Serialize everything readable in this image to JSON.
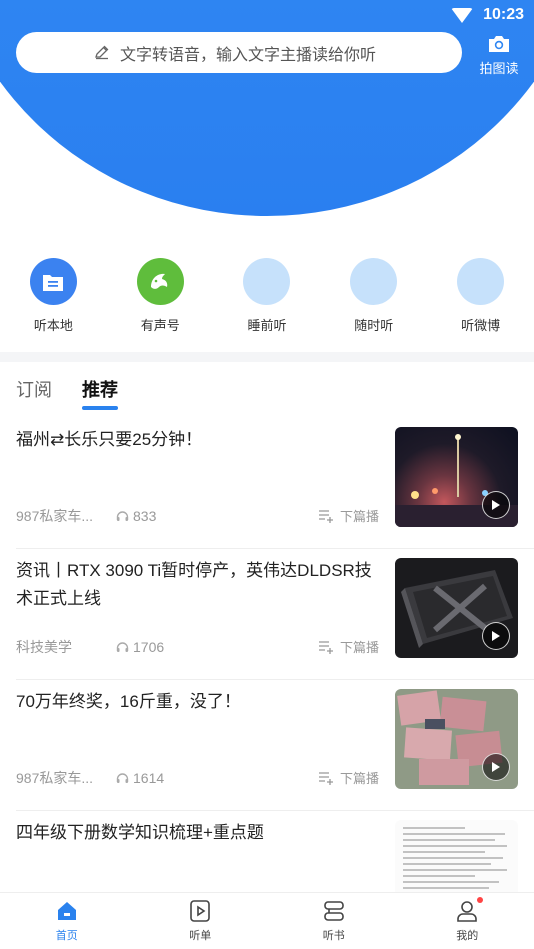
{
  "status": {
    "time": "10:23"
  },
  "search": {
    "placeholder": "文字转语音，输入文字主播读给你听"
  },
  "photo_read": {
    "label": "拍图读"
  },
  "categories": [
    {
      "label": "听本地",
      "icon": "file-list-icon",
      "color": "#3b82f0"
    },
    {
      "label": "有声号",
      "icon": "dolphin-icon",
      "color": "#5fbd3c"
    },
    {
      "label": "睡前听",
      "icon": "circle-placeholder-icon",
      "color": "#c6e1fb"
    },
    {
      "label": "随时听",
      "icon": "circle-placeholder-icon",
      "color": "#c6e1fb"
    },
    {
      "label": "听微博",
      "icon": "circle-placeholder-icon",
      "color": "#c6e1fb"
    }
  ],
  "tabs": [
    {
      "label": "订阅"
    },
    {
      "label": "推荐"
    }
  ],
  "feed": [
    {
      "title": "福州⇄长乐只要25分钟！",
      "source": "987私家车...",
      "listens": "833",
      "next": "下篇播"
    },
    {
      "title": "资讯丨RTX 3090 Ti暂时停产，英伟达DLDSR技术正式上线",
      "source": "科技美学",
      "listens": "1706",
      "next": "下篇播"
    },
    {
      "title": "70万年终奖，16斤重，没了！",
      "source": "987私家车...",
      "listens": "1614",
      "next": "下篇播"
    },
    {
      "title": "四年级下册数学知识梳理+重点题",
      "source": "",
      "listens": "",
      "next": ""
    }
  ],
  "bottom_nav": [
    {
      "label": "首页",
      "icon": "home-icon"
    },
    {
      "label": "听单",
      "icon": "play-square-icon"
    },
    {
      "label": "听书",
      "icon": "book-icon"
    },
    {
      "label": "我的",
      "icon": "user-icon"
    }
  ],
  "colors": {
    "accent": "#2a82ee",
    "hero": "#2f86f2"
  }
}
